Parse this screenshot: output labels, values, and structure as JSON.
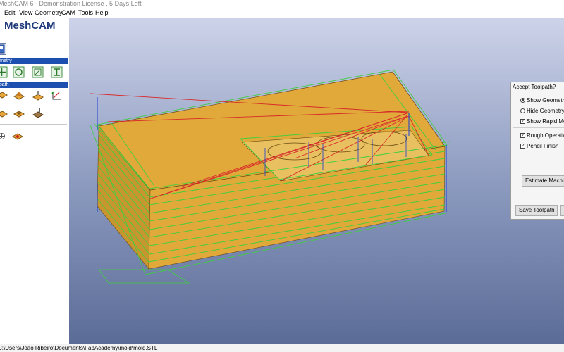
{
  "window": {
    "title": "MeshCAM 6 - Demonstration License , 5 Days Left"
  },
  "menu": {
    "items": [
      "Edit",
      "View",
      "Geometry",
      "CAM",
      "Tools",
      "Help"
    ]
  },
  "sidebar": {
    "logo": "MeshCAM",
    "sections": [
      {
        "title": "Geometry",
        "icons": [
          "move-icon",
          "rotate-icon",
          "scale-icon",
          "dimensions-icon"
        ]
      },
      {
        "title": "Toolpath",
        "icons": [
          "define-stock-icon",
          "set-origin-icon",
          "machining-region-icon",
          "depth-icon",
          "waterline-icon",
          "hole-icon",
          "drill-icon",
          "show-toolpath-icon",
          "tool-icon"
        ]
      }
    ]
  },
  "status": {
    "path": "C:\\Users\\João Ribeiro\\Documents\\FabAcademy\\mold\\mold.STL"
  },
  "dialog": {
    "title": "Accept Toolpath?",
    "show_geometry": "Show Geometry",
    "hide_geometry": "Hide Geometry",
    "show_rapid": "Show Rapid Mo",
    "rough": "Rough Operatio",
    "pencil": "Pencil Finish",
    "estimate": "Estimate Machinin",
    "save": "Save Toolpath"
  },
  "colors": {
    "accent": "#1c4fb0",
    "viewport_top": "#c8cfe6",
    "viewport_bottom": "#5d6f9a",
    "part": "#e0a93a",
    "toolpath": "#3ecf3e",
    "rapid": "#d82a2a"
  }
}
